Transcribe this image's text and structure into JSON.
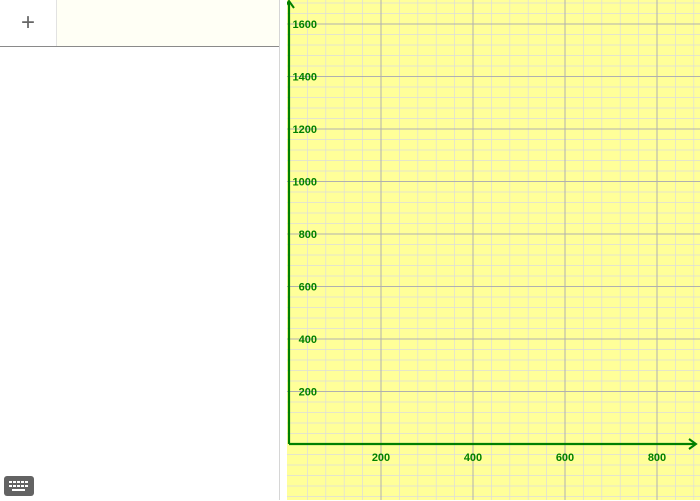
{
  "algebra": {
    "add_label": "+",
    "add_icon": "plus-icon"
  },
  "graphics": {
    "background": "#ffff99",
    "axis_color": "#008000",
    "major_grid_color": "#b0b0b0",
    "minor_grid_color": "#dcdcdc",
    "x_ticks": [
      "200",
      "400",
      "600",
      "800"
    ],
    "y_ticks": [
      "200",
      "400",
      "600",
      "800",
      "1000",
      "1200",
      "1400",
      "1600"
    ]
  },
  "keyboard": {
    "icon": "keyboard-icon"
  }
}
